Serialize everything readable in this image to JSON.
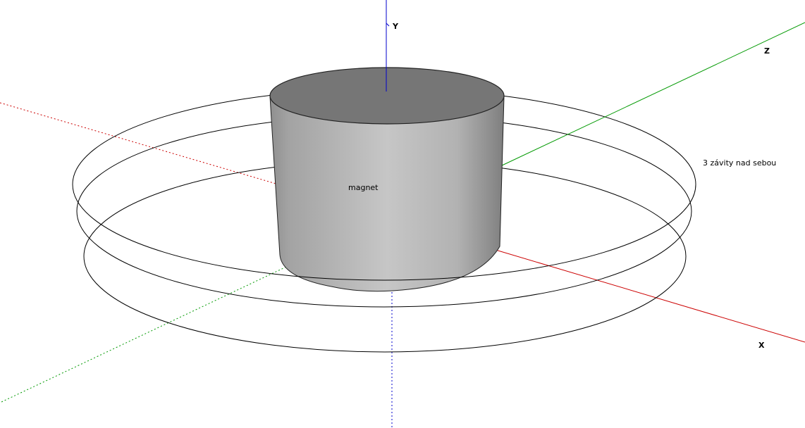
{
  "axes": {
    "y_label": "Y",
    "z_label": "Z",
    "x_label": "X"
  },
  "magnet_label": "magnet",
  "coils_note": "3 závity nad sebou",
  "colors": {
    "background": "#ffffff",
    "x_axis": "#cc0000",
    "y_axis": "#0000cc",
    "z_axis": "#009900",
    "coil": "#000000",
    "magnet_top": "#767676",
    "magnet_side_light": "#c4c4c4",
    "magnet_side_dark": "#8a8a8a"
  }
}
